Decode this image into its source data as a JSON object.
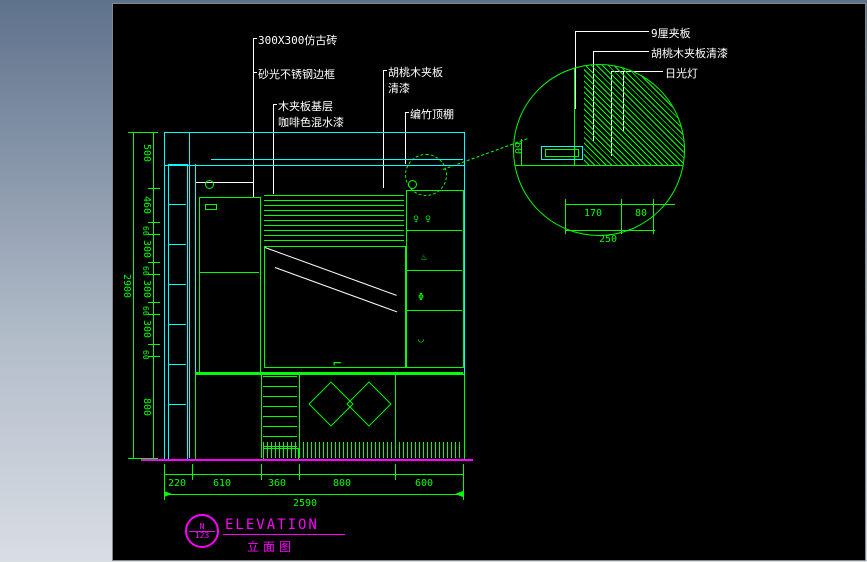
{
  "labels": {
    "l1": "300X300仿古砖",
    "l2": "砂光不锈钢边框",
    "l3": "木夹板基层\n咖啡色混水漆",
    "l4": "胡桃木夹板\n清漆",
    "l5": "编竹顶棚",
    "l6": "9厘夹板",
    "l7": "胡桃木夹板清漆",
    "l8": "日光灯"
  },
  "dims": {
    "v_total": "2900",
    "v1": "500",
    "v2": "460",
    "v3": "60",
    "v4": "300",
    "v5": "60",
    "v6": "300",
    "v7": "60",
    "v8": "300",
    "v9": "60",
    "v10": "800",
    "h1": "220",
    "h2": "610",
    "h3": "360",
    "h4": "800",
    "h5": "600",
    "h_total": "2590",
    "d1": "170",
    "d2": "80",
    "d_total": "250",
    "d_v": "60"
  },
  "title": {
    "en": "ELEVATION",
    "zh": "立面图",
    "north": "N",
    "num": "123"
  }
}
